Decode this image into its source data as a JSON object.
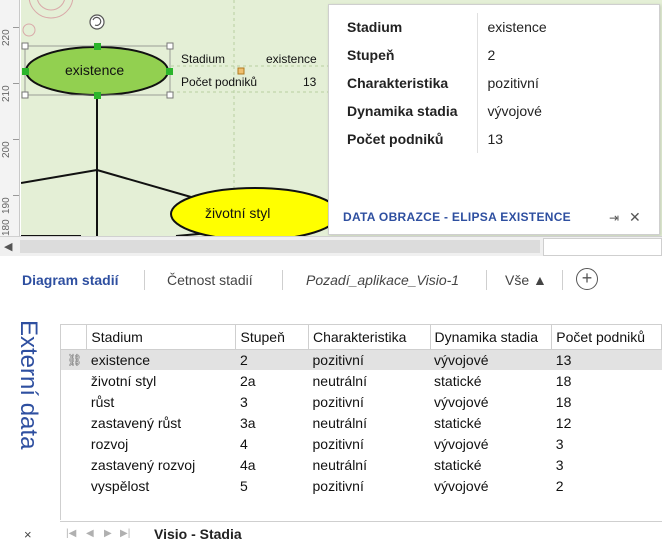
{
  "ruler": {
    "labels": [
      "220",
      "210",
      "200",
      "190",
      "180"
    ]
  },
  "canvas": {
    "shapes": {
      "existence_label": "existence",
      "zivotni_styl_label": "životní styl",
      "data_rows": [
        {
          "key": "Stadium",
          "value": "existence"
        },
        {
          "key": "Počet podniků",
          "value": "13"
        }
      ]
    },
    "colors": {
      "background": "#e4efd6",
      "existence_fill": "#92d050",
      "zivotni_styl_fill": "#ffff00",
      "selection_handle": "#2bb52b"
    }
  },
  "popup": {
    "rows": [
      {
        "key": "Stadium",
        "value": "existence"
      },
      {
        "key": "Stupeň",
        "value": "2"
      },
      {
        "key": "Charakteristika",
        "value": "pozitivní"
      },
      {
        "key": "Dynamika stadia",
        "value": "vývojové"
      },
      {
        "key": "Počet podniků",
        "value": "13"
      }
    ],
    "title": "DATA OBRAZCE - ELIPSA EXISTENCE",
    "pin_icon": "pin-icon",
    "close_icon": "close-icon"
  },
  "tabs": {
    "items": [
      "Diagram stadií",
      "Četnost stadií",
      "Pozadí_aplikace_Visio-1",
      "Vše ▲"
    ],
    "active_index": 0,
    "add_label": "+"
  },
  "external_data": {
    "title": "Externí data",
    "close_label": "×",
    "columns": [
      "Stadium",
      "Stupeň",
      "Charakteristika",
      "Dynamika stadia",
      "Počet podniků"
    ],
    "rows": [
      [
        "existence",
        "2",
        "pozitivní",
        "vývojové",
        "13"
      ],
      [
        "životní styl",
        "2a",
        "neutrální",
        "statické",
        "18"
      ],
      [
        "růst",
        "3",
        "pozitivní",
        "vývojové",
        "18"
      ],
      [
        "zastavený růst",
        "3a",
        "neutrální",
        "statické",
        "12"
      ],
      [
        "rozvoj",
        "4",
        "pozitivní",
        "vývojové",
        "3"
      ],
      [
        "zastavený rozvoj",
        "4a",
        "neutrální",
        "statické",
        "3"
      ],
      [
        "vyspělost",
        "5",
        "pozitivní",
        "vývojové",
        "2"
      ]
    ],
    "linked_row_index": 0,
    "sheet_tab": "Visio - Stadia"
  }
}
